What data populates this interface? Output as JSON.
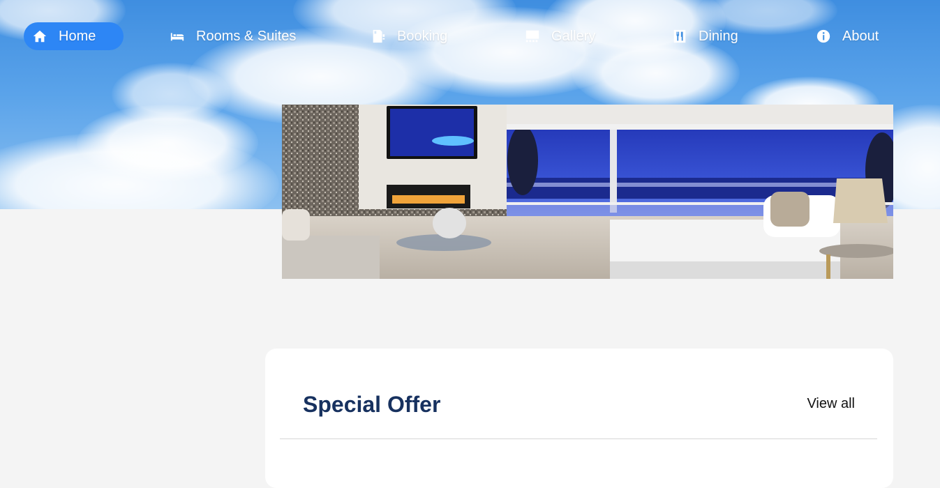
{
  "nav": {
    "items": [
      {
        "label": "Home",
        "icon": "home-icon",
        "active": true
      },
      {
        "label": "Rooms & Suites",
        "icon": "bed-icon",
        "active": false
      },
      {
        "label": "Booking",
        "icon": "booking-icon",
        "active": false
      },
      {
        "label": "Gallery",
        "icon": "gallery-icon",
        "active": false
      },
      {
        "label": "Dining",
        "icon": "dining-icon",
        "active": false
      },
      {
        "label": "About",
        "icon": "info-icon",
        "active": false
      }
    ]
  },
  "special_offer": {
    "title": "Special Offer",
    "view_all_label": "View all"
  },
  "colors": {
    "accent": "#2d86f5",
    "title": "#17315f",
    "page_background": "#f4f4f4"
  }
}
